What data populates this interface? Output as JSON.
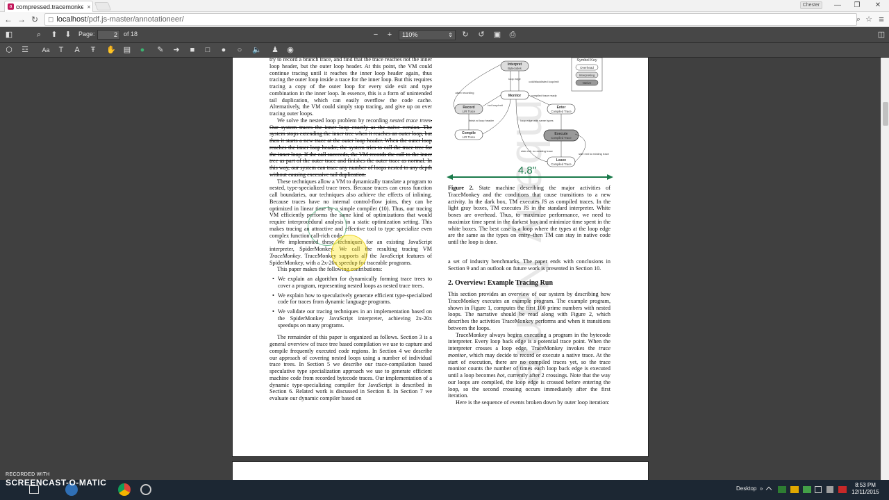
{
  "browser": {
    "tab_title": "compressed.tracemonkey",
    "tab_close": "×",
    "profile_name": "Chester",
    "url_host": "localhost",
    "url_path": "/pdf.js-master/annotationeer/",
    "min_glyph": "—",
    "restore_glyph": "❐",
    "close_glyph": "✕",
    "back_glyph": "←",
    "forward_glyph": "→",
    "reload_glyph": "↻",
    "page_icon_glyph": "◻",
    "lens_glyph": "⌕",
    "star_glyph": "☆",
    "menu_glyph": "≡"
  },
  "viewer_toolbar": {
    "sidebar_glyph": "◧",
    "search_glyph": "⌕",
    "prev_glyph": "⬆",
    "next_glyph": "⬇",
    "page_label": "Page:",
    "page_value": "2",
    "page_count": "of 18",
    "zoom_out_glyph": "−",
    "zoom_in_glyph": "+",
    "zoom_value": "110%",
    "zoom_arrow": "⇕",
    "rotate_cw_glyph": "↻",
    "rotate_ccw_glyph": "↺",
    "save_glyph": "▣",
    "print_glyph": "⎙",
    "outline_glyph": "◫"
  },
  "annotation_toolbar": {
    "icons": [
      "select-icon",
      "highlight-icon",
      "font-icon",
      "text-box-icon",
      "text-color-icon",
      "strikeout-icon",
      "hand-icon",
      "note-icon",
      "pin-icon",
      "pencil-icon",
      "arrow-icon",
      "fill-rect-icon",
      "rect-icon",
      "fill-circle-icon",
      "circle-icon",
      "audio-icon",
      "stamp-icon",
      "camera-icon"
    ],
    "glyphs": [
      "⬡",
      "☲",
      "Aa",
      "T",
      "A",
      "Ŧ",
      "✋",
      "▤",
      "●",
      "✎",
      "➜",
      "■",
      "□",
      "●",
      "○",
      "🔈",
      "♟",
      "◉"
    ],
    "pin_color": "#3cb371"
  },
  "pdf": {
    "left_column": {
      "para1": "try to record a branch trace, and find that the trace reaches not the inner loop header, but the outer loop header. At this point, the VM could continue tracing until it reaches the inner loop header again, thus tracing the outer loop inside a trace for the inner loop. But this requires tracing a copy of the outer loop for every side exit and type combination in the inner loop. In essence, this is a form of unintended tail duplication, which can easily overflow the code cache. Alternatively, the VM could simply stop tracing, and give up on ever tracing outer loops.",
      "para2a": "We solve the nested loop problem by recording ",
      "para2b": "nested trace trees",
      "para2c": ". Our system traces the inner loop exactly as the naive version. The system stops extending the inner tree when it reaches an outer loop, but then it starts a new trace at the outer loop header. When the outer loop reaches the inner loop header, the system tries to call the trace tree for the inner loop. If the call succeeds, the VM records the call to the inner tree as part of the outer trace and finishes the outer trace as normal. In this way, our system can trace any number of loops nested to any depth without causing excessive tail duplication.",
      "para3": "These techniques allow a VM to dynamically translate a program to nested, type-specialized trace trees. Because traces can cross function call boundaries, our techniques also achieve the effects of inlining. Because traces have no internal control-flow joins, they can be optimized in linear time by a simple compiler (10). Thus, our tracing VM efficiently performs the same kind of optimizations that would require interprocedural analysis in a static optimization setting. This makes tracing an attractive and effective tool to type specialize even complex function call-rich code.",
      "para4a": "We implemented these techniques for an existing JavaScript interpreter, SpiderMonkey. We call the resulting tracing VM ",
      "para4b": "TraceMonkey",
      "para4c": ". TraceMonkey supports all the JavaScript features of SpiderMonkey, with a 2x-20x speedup for traceable programs.",
      "para5": "This paper makes the following contributions:",
      "bullet1": "We explain an algorithm for dynamically forming trace trees to cover a program, representing nested loops as nested trace trees.",
      "bullet2": "We explain how to speculatively generate efficient type-specialized code for traces from dynamic language programs.",
      "bullet3": "We validate our tracing techniques in an implementation based on the SpiderMonkey JavaScript interpreter, achieving 2x-20x speedups on many programs.",
      "para6": "The remainder of this paper is organized as follows. Section 3 is a general overview of trace tree based compilation we use to capture and compile frequently executed code regions. In Section 4 we describe our approach of covering nested loops using a number of individual trace trees. In Section 5 we describe our trace-compilation based speculative type specialization approach we use to generate efficient machine code from recorded bytecode traces. Our implementation of a dynamic type-specializing compiler for JavaScript is described in Section 6. Related work is discussed in Section 8. In Section 7 we evaluate our dynamic compiler based on"
    },
    "right_column": {
      "caption_label": "Figure 2.",
      "caption_text": " State machine describing the major activities of TraceMonkey and the conditions that cause transitions to a new activity. In the dark box, TM executes JS as compiled traces. In the light gray boxes, TM executes JS in the standard interpreter. White boxes are overhead. Thus, to maximize performance, we need to maximize time spent in the darkest box and minimize time spent in the white boxes. The best case is a loop where the types at the loop edge are the same as the types on entry–then TM can stay in native code until the loop is done.",
      "para1": "a set of industry benchmarks. The paper ends with conclusions in Section 9 and an outlook on future work is presented in Section 10.",
      "heading": "2.   Overview: Example Tracing Run",
      "para2": "This section provides an overview of our system by describing how TraceMonkey executes an example program. The example program, shown in Figure 1, computes the first 100 prime numbers with nested loops. The narrative should be read along with Figure 2, which describes the activities TraceMonkey performs and when it transitions between the loops.",
      "para3a": "TraceMonkey always begins executing a program in the bytecode interpreter. Every loop back edge is a potential trace point. When the interpreter crosses a loop edge, TraceMonkey invokes the ",
      "para3b": "trace monitor",
      "para3c": ", which may decide to record or execute a native trace. At the start of execution, there are no compiled traces yet, so the trace monitor counts the number of times each loop back edge is executed until a loop becomes ",
      "para3d": "hot",
      "para3e": ", currently after 2 crossings. Note that the way our loops are compiled, the loop edge is crossed before entering the loop, so the second crossing occurs immediately after the first iteration.",
      "para4": "Here is the sequence of events broken down by outer loop iteration:"
    },
    "figure": {
      "symbol_key_title": "Symbol Key",
      "key_items": [
        "Overhead",
        "Interpreting",
        "Native"
      ],
      "nodes": {
        "interpret": [
          "Interpret",
          "Bytecodes"
        ],
        "monitor": [
          "Monitor"
        ],
        "record": [
          "Record",
          "LIR Trace"
        ],
        "enter": [
          "Enter",
          "Compiled Trace"
        ],
        "compile": [
          "Compile",
          "LIR Trace"
        ],
        "execute": [
          "Execute",
          "Compiled Trace"
        ],
        "leave": [
          "Leave",
          "Compiled Trace"
        ]
      },
      "edge_labels": [
        "loop edge",
        "cold/blacklisted loop/exit",
        "abort recording",
        "hot loop/exit",
        "compiled trace ready",
        "finish at loop header",
        "loop edge with same types",
        "side exit, no existing trace",
        "side exit to existing trace"
      ],
      "dimension": "4.8\"",
      "dimension_color": "#1a7a4a"
    },
    "watermark": "mbany Name"
  },
  "recording": {
    "line1": "RECORDED WITH",
    "line2": "SCREENCAST-O-MATIC"
  },
  "taskbar": {
    "desktop_label": "Desktop",
    "tray_arrows": "»",
    "time": "8:53 PM",
    "date": "12/11/2015"
  }
}
